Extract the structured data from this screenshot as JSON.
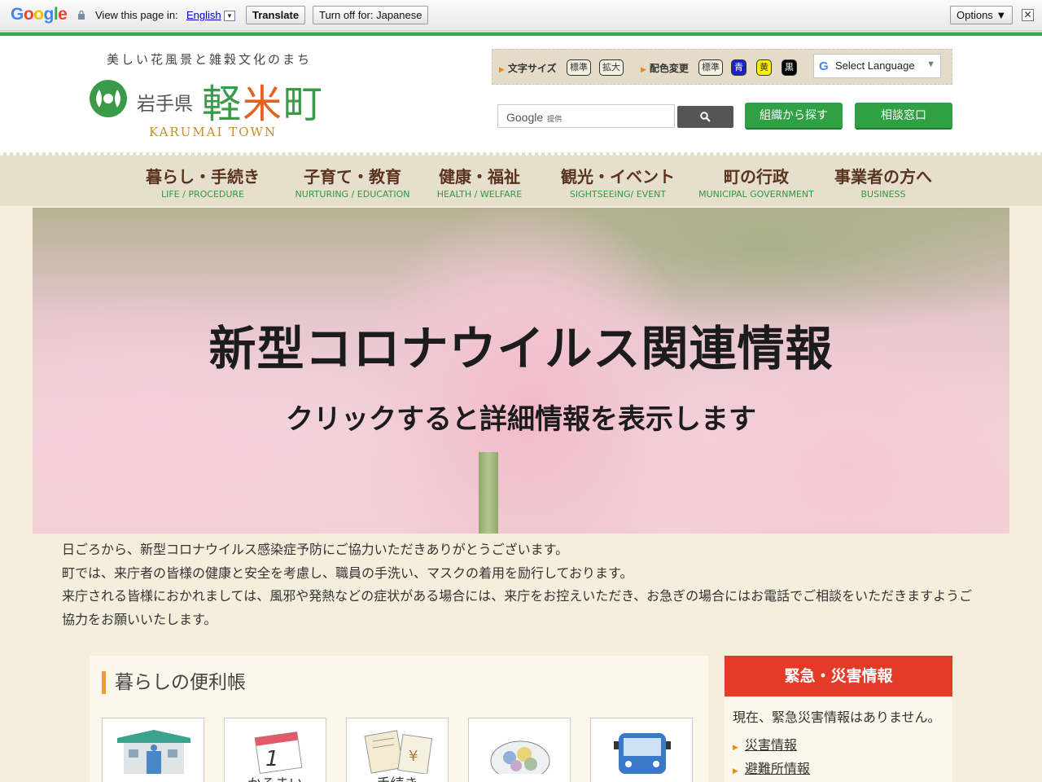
{
  "translate_bar": {
    "view_text": "View this page in:",
    "language": "English",
    "translate_btn": "Translate",
    "turn_off_btn": "Turn off for: Japanese",
    "options_btn": "Options ▼"
  },
  "header": {
    "tagline": "美しい花風景と雑穀文化のまち",
    "prefecture": "岩手県",
    "town_1": "軽",
    "town_2": "米",
    "town_3": "町",
    "town_en": "KARUMAI TOWN",
    "font_size_label": "文字サイズ",
    "font_std": "標準",
    "font_big": "拡大",
    "color_label": "配色変更",
    "color_std": "標準",
    "color_blue": "青",
    "color_yellow": "黄",
    "color_black": "黒",
    "select_language": "Select Language",
    "search_brand": "Google",
    "search_provided": "提供",
    "org_search_btn": "組織から探す",
    "consult_btn": "相談窓口"
  },
  "nav": [
    {
      "jp": "暮らし・手続き",
      "en": "LIFE / PROCEDURE"
    },
    {
      "jp": "子育て・教育",
      "en": "NURTURING / EDUCATION"
    },
    {
      "jp": "健康・福祉",
      "en": "HEALTH / WELFARE"
    },
    {
      "jp": "観光・イベント",
      "en": "SIGHTSEEING/ EVENT"
    },
    {
      "jp": "町の行政",
      "en": "MUNICIPAL GOVERNMENT"
    },
    {
      "jp": "事業者の方へ",
      "en": "BUSINESS"
    }
  ],
  "hero": {
    "title": "新型コロナウイルス関連情報",
    "subtitle": "クリックすると詳細情報を表示します"
  },
  "notice": [
    "日ごろから、新型コロナウイルス感染症予防にご協力いただきありがとうございます。",
    "町では、来庁者の皆様の健康と安全を考慮し、職員の手洗い、マスクの着用を励行しております。",
    "来庁される皆様におかれましては、風邪や発熱などの症状がある場合には、来庁をお控えいただき、お急ぎの場合にはお電話でご相談をいただきますようご協力をお願いいたします。"
  ],
  "convenience": {
    "title": "暮らしの便利帳",
    "cards": [
      {
        "label": "",
        "icon": "building-icon"
      },
      {
        "label": "かるまい",
        "icon": "calendar-icon"
      },
      {
        "label": "手続き",
        "icon": "documents-icon"
      },
      {
        "label": "",
        "icon": "garbage-bag-icon"
      },
      {
        "label": "",
        "icon": "bus-icon"
      }
    ]
  },
  "emergency": {
    "title": "緊急・災害情報",
    "message": "現在、緊急災害情報はありません。",
    "links": [
      "災害情報",
      "避難所情報"
    ]
  }
}
